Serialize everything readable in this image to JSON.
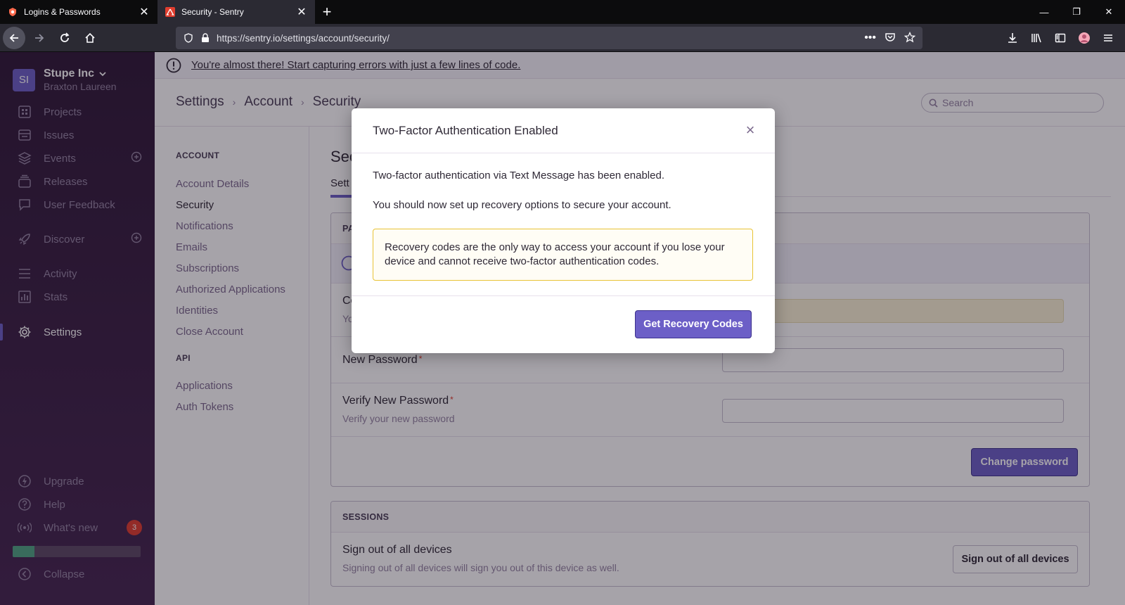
{
  "browser": {
    "tabs": [
      {
        "title": "Logins & Passwords",
        "active": false
      },
      {
        "title": "Security - Sentry",
        "active": true
      }
    ],
    "url": "https://sentry.io/settings/account/security/"
  },
  "sidebar": {
    "org_initials": "SI",
    "org_name": "Stupe Inc",
    "user_name": "Braxton Laureen",
    "items": [
      {
        "label": "Projects"
      },
      {
        "label": "Issues"
      },
      {
        "label": "Events"
      },
      {
        "label": "Releases"
      },
      {
        "label": "User Feedback"
      },
      {
        "label": "Discover"
      },
      {
        "label": "Activity"
      },
      {
        "label": "Stats"
      },
      {
        "label": "Settings"
      }
    ],
    "bottom_items": [
      {
        "label": "Upgrade"
      },
      {
        "label": "Help"
      },
      {
        "label": "What's new",
        "badge": "3"
      },
      {
        "label": "Collapse"
      }
    ],
    "progress": 0.17
  },
  "banner": {
    "text": "You're almost there! Start capturing errors with just a few lines of code."
  },
  "header": {
    "breadcrumb": [
      "Settings",
      "Account",
      "Security"
    ],
    "search_placeholder": "Search"
  },
  "subnav": {
    "account_heading": "ACCOUNT",
    "account_items": [
      "Account Details",
      "Security",
      "Notifications",
      "Emails",
      "Subscriptions",
      "Authorized Applications",
      "Identities",
      "Close Account"
    ],
    "api_heading": "API",
    "api_items": [
      "Applications",
      "Auth Tokens"
    ]
  },
  "content": {
    "title": "Sec",
    "tab": "Sett",
    "password_panel_head": "PA",
    "current_password_label": "Co",
    "current_password_help": "Yo",
    "current_password_value": "••••••••••",
    "new_password_label": "New Password",
    "verify_password_label": "Verify New Password",
    "verify_password_help": "Verify your new password",
    "change_password_button": "Change password",
    "sessions_head": "SESSIONS",
    "signout_label": "Sign out of all devices",
    "signout_help": "Signing out of all devices will sign you out of this device as well.",
    "signout_button": "Sign out of all devices"
  },
  "modal": {
    "title": "Two-Factor Authentication Enabled",
    "close": "×",
    "line1": "Two-factor authentication via Text Message has been enabled.",
    "line2": "You should now set up recovery options to secure your account.",
    "alert": "Recovery codes are the only way to access your account if you lose your device and cannot receive two-factor authentication codes.",
    "button": "Get Recovery Codes"
  },
  "colors": {
    "accent": "#6c5fc7",
    "sidebar": "#2f1937",
    "alert_border": "#e8c335",
    "badge": "#e03e2f"
  }
}
